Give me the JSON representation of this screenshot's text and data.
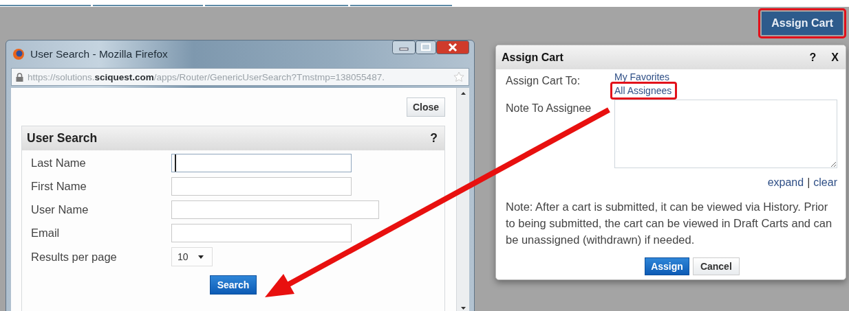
{
  "assign_cart_button": {
    "label": "Assign Cart",
    "highlighted": true
  },
  "popup_window": {
    "title": "User Search - Mozilla Firefox",
    "url": "https://solutions.**sciquest.com**/apps/Router/GenericUserSearch?Tmstmp=138055487.",
    "close_button": "Close",
    "panel": {
      "title": "User Search",
      "help": "?",
      "fields": [
        {
          "label": "Last Name",
          "kind": "text",
          "focused": true,
          "wide": false
        },
        {
          "label": "First Name",
          "kind": "text",
          "focused": false,
          "wide": false
        },
        {
          "label": "User Name",
          "kind": "text",
          "focused": false,
          "wide": true
        },
        {
          "label": "Email",
          "kind": "text",
          "focused": false,
          "wide": false
        },
        {
          "label": "Results per page",
          "kind": "select",
          "value": "10"
        }
      ],
      "search_button": "Search"
    }
  },
  "assign_dialog": {
    "title": "Assign Cart",
    "help": "?",
    "close": "X",
    "assign_to_label": "Assign Cart To:",
    "options": [
      {
        "label": "My Favorites",
        "highlighted": false
      },
      {
        "label": "All Assignees",
        "highlighted": true
      }
    ],
    "note_label": "Note To Assignee",
    "links": [
      "expand",
      "clear"
    ],
    "link_separator": "|",
    "note": "Note: After a cart is submitted, it can be viewed via History. Prior to being submitted, the cart can be viewed in Draft Carts and can be unassigned (withdrawn) if needed.",
    "buttons": [
      {
        "label": "Assign",
        "kind": "primary"
      },
      {
        "label": "Cancel",
        "kind": "secondary"
      }
    ]
  }
}
